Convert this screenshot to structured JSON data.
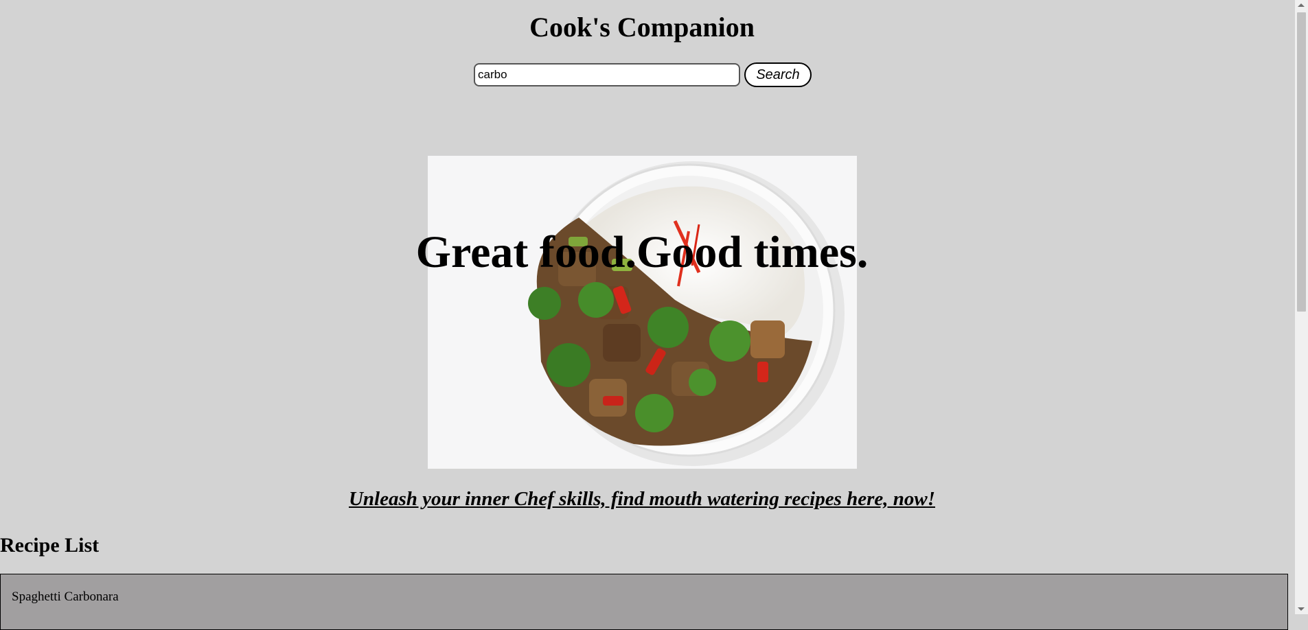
{
  "header": {
    "title": "Cook's Companion"
  },
  "search": {
    "value": "carbo",
    "button_label": "Search"
  },
  "hero": {
    "heading": "Great food.Good times."
  },
  "tagline": "Unleash your inner Chef skills, find mouth watering recipes here, now!",
  "recipes": {
    "heading": "Recipe List",
    "items": [
      "Spaghetti Carbonara"
    ]
  }
}
